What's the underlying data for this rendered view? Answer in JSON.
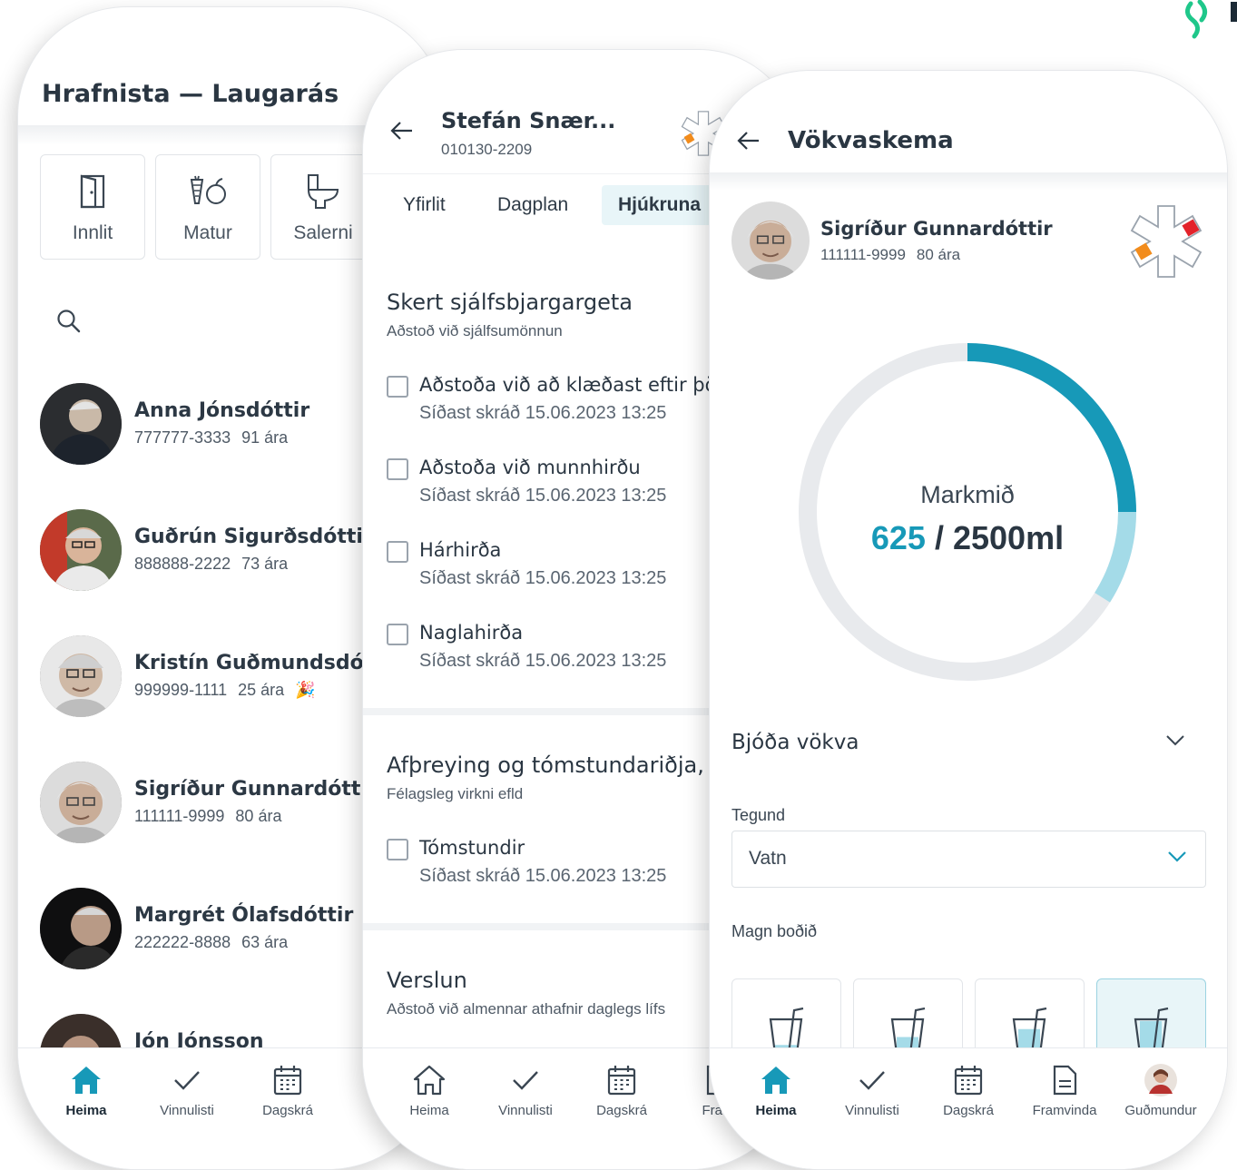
{
  "colors": {
    "accent": "#1799b8",
    "accent_light": "#a4dbe8",
    "track": "#e8eaed",
    "text": "#2a3642"
  },
  "screen1": {
    "title": "Hrafnista — Laugarás",
    "tiles": [
      {
        "label": "Innlit",
        "icon": "door-icon"
      },
      {
        "label": "Matur",
        "icon": "food-icon"
      },
      {
        "label": "Salerni",
        "icon": "toilet-icon"
      }
    ],
    "search_icon": "search-icon",
    "residents": [
      {
        "name": "Anna Jónsdóttir",
        "id": "777777-3333",
        "age": "91 ára"
      },
      {
        "name": "Guðrún Sigurðsdóttir",
        "id": "888888-2222",
        "age": "73 ára"
      },
      {
        "name": "Kristín Guðmundsdótti",
        "id": "999999-1111",
        "age": "25 ára",
        "badge": "🎉"
      },
      {
        "name": "Sigríður Gunnardóttir",
        "id": "111111-9999",
        "age": "80 ára"
      },
      {
        "name": "Margrét Ólafsdóttir",
        "id": "222222-8888",
        "age": "63 ára"
      },
      {
        "name": "Jón Jónsson",
        "id": "",
        "age": ""
      }
    ],
    "nav": [
      {
        "label": "Heima",
        "icon": "home-icon",
        "active": true
      },
      {
        "label": "Vinnulisti",
        "icon": "check-icon"
      },
      {
        "label": "Dagskrá",
        "icon": "calendar-icon"
      },
      {
        "label": "Fr",
        "icon": "document-icon"
      }
    ]
  },
  "screen2": {
    "name": "Stefán Snær...",
    "id": "010130-2209",
    "tabs": [
      {
        "label": "Yfirlit"
      },
      {
        "label": "Dagplan"
      },
      {
        "label": "Hjúkruna",
        "active": true
      }
    ],
    "sections": [
      {
        "title": "Skert sjálfsbjargargeta",
        "subtitle": "Aðstoð við sjálfsumönnun",
        "tasks": [
          {
            "name": "Aðstoða við að klæðast eftir þör",
            "last": "Síðast skráð 15.06.2023 13:25"
          },
          {
            "name": "Aðstoða við munnhirðu",
            "last": "Síðast skráð 15.06.2023 13:25"
          },
          {
            "name": "Hárhirða",
            "last": "Síðast skráð 15.06.2023 13:25"
          },
          {
            "name": "Naglahirða",
            "last": "Síðast skráð 15.06.2023 13:25"
          }
        ]
      },
      {
        "title": "Afþreying og tómstundariðja, d",
        "subtitle": "Félagsleg virkni efld",
        "tasks": [
          {
            "name": "Tómstundir",
            "last": "Síðast skráð 15.06.2023 13:25"
          }
        ]
      },
      {
        "title": "Verslun",
        "subtitle": "Aðstoð við almennar athafnir daglegs lífs",
        "tasks": []
      }
    ],
    "nav": [
      {
        "label": "Heima",
        "icon": "home-icon"
      },
      {
        "label": "Vinnulisti",
        "icon": "check-icon"
      },
      {
        "label": "Dagskrá",
        "icon": "calendar-icon"
      },
      {
        "label": "Fram",
        "icon": "document-icon"
      }
    ]
  },
  "screen3": {
    "title": "Vökvaskema",
    "resident": {
      "name": "Sigríður Gunnardóttir",
      "id": "111111-9999",
      "age": "80 ára"
    },
    "goal_label": "Markmið",
    "goal_current": "625",
    "goal_sep": " / ",
    "goal_target": "2500ml",
    "progress_fraction": 0.25,
    "planned_fraction": 0.09,
    "offer_label": "Bjóða vökva",
    "type_label": "Tegund",
    "type_value": "Vatn",
    "amount_label": "Magn boðið",
    "cups": [
      {
        "fill": 0.25
      },
      {
        "fill": 0.5
      },
      {
        "fill": 0.75
      },
      {
        "fill": 1.0,
        "selected": true
      }
    ],
    "nav": [
      {
        "label": "Heima",
        "icon": "home-icon",
        "active": true
      },
      {
        "label": "Vinnulisti",
        "icon": "check-icon"
      },
      {
        "label": "Dagskrá",
        "icon": "calendar-icon"
      },
      {
        "label": "Framvinda",
        "icon": "document-icon"
      },
      {
        "label": "Guðmundur",
        "icon": "profile-avatar"
      }
    ]
  }
}
